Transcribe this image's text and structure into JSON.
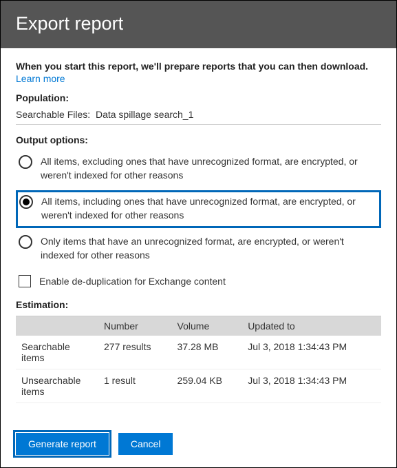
{
  "header": {
    "title": "Export report"
  },
  "intro": {
    "text": "When you start this report, we'll prepare reports that you can then download.",
    "learn_more": "Learn more"
  },
  "population": {
    "label": "Population:",
    "prefix": "Searchable Files:",
    "value": "Data spillage search_1"
  },
  "output": {
    "label": "Output options:",
    "options": [
      "All items, excluding ones that have unrecognized format, are encrypted, or weren't indexed for other reasons",
      "All items, including ones that have unrecognized format, are encrypted, or weren't indexed for other reasons",
      "Only items that have an unrecognized format, are encrypted, or weren't indexed for other reasons"
    ],
    "dedup_label": "Enable de-duplication for Exchange content"
  },
  "estimation": {
    "label": "Estimation:",
    "columns": [
      "",
      "Number",
      "Volume",
      "Updated to"
    ],
    "rows": [
      {
        "name": "Searchable items",
        "number": "277 results",
        "volume": "37.28 MB",
        "updated": "Jul 3, 2018 1:34:43 PM"
      },
      {
        "name": "Unsearchable items",
        "number": "1 result",
        "volume": "259.04 KB",
        "updated": "Jul 3, 2018 1:34:43 PM"
      }
    ]
  },
  "buttons": {
    "generate": "Generate report",
    "cancel": "Cancel"
  }
}
